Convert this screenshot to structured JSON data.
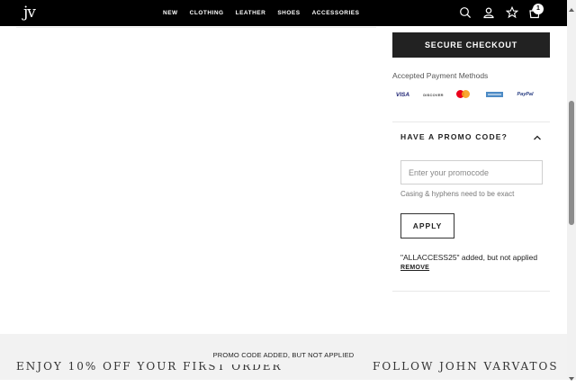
{
  "header": {
    "logo": "jv",
    "nav": [
      "NEW",
      "CLOTHING",
      "LEATHER",
      "SHOES",
      "ACCESSORIES"
    ],
    "cart_count": "1",
    "icons": [
      "search-icon",
      "account-icon",
      "wishlist-star-icon",
      "cart-bag-icon"
    ]
  },
  "checkout": {
    "button_label": "SECURE CHECKOUT"
  },
  "payment": {
    "title": "Accepted Payment Methods",
    "methods": [
      "VISA",
      "DISCOVER",
      "Mastercard",
      "AMERICAN EXPRESS",
      "PayPal"
    ]
  },
  "promo": {
    "title": "HAVE A PROMO CODE?",
    "input_placeholder": "Enter your promocode",
    "input_value": "",
    "hint": "Casing & hyphens need to be exact",
    "apply_label": "APPLY",
    "applied_message": "\"ALLACCESS25\" added, but not applied",
    "remove_label": "REMOVE"
  },
  "footer": {
    "left_text": "ENJOY 10% OFF YOUR FIRST ORDER",
    "right_text": "FOLLOW JOHN VARVATOS"
  },
  "toast": {
    "message": "PROMO CODE ADDED, BUT NOT APPLIED"
  },
  "colors": {
    "header_bg": "#000000",
    "button_dark": "#222222",
    "footer_bg": "#f2f2f2"
  }
}
